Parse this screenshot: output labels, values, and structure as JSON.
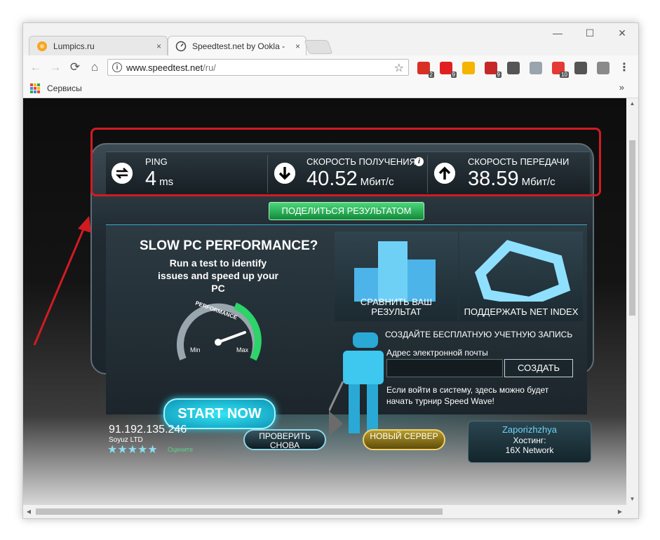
{
  "browser": {
    "tabs": [
      {
        "title": "Lumpics.ru",
        "close": "×"
      },
      {
        "title": "Speedtest.net by Ookla -",
        "close": "×"
      }
    ],
    "window_controls": {
      "minimize": "—",
      "maximize": "☐",
      "close": "✕"
    },
    "nav": {
      "back": "←",
      "forward": "→",
      "reload": "⟳",
      "home": "⌂"
    },
    "address": {
      "host": "www.speedtest.net",
      "path": "/ru/",
      "info": "i",
      "star": "☆"
    },
    "extensions": [
      {
        "name": "gmail-icon",
        "badge": "2",
        "color": "#d93025"
      },
      {
        "name": "opera-icon",
        "badge": "9",
        "color": "#e02020"
      },
      {
        "name": "paw-icon",
        "badge": "",
        "color": "#f4b400"
      },
      {
        "name": "adblock-icon",
        "badge": "9",
        "color": "#c62828"
      },
      {
        "name": "film-icon",
        "badge": "",
        "color": "#555555"
      },
      {
        "name": "vk-icon",
        "badge": "",
        "color": "#9aa4ad"
      },
      {
        "name": "red-icon",
        "badge": "10",
        "color": "#e53935"
      },
      {
        "name": "eye-icon",
        "badge": "",
        "color": "#555555"
      },
      {
        "name": "cloud-icon",
        "badge": "",
        "color": "#8a8a8a"
      }
    ],
    "menu": "⋮",
    "bookmarks": {
      "apps_label": "Сервисы",
      "more": "»"
    }
  },
  "speedtest": {
    "ping": {
      "label": "PING",
      "value": "4",
      "unit": "ms"
    },
    "download": {
      "label": "СКОРОСТЬ ПОЛУЧЕНИЯ",
      "value": "40.52",
      "unit": "Мбит/с"
    },
    "upload": {
      "label": "СКОРОСТЬ ПЕРЕДАЧИ",
      "value": "38.59",
      "unit": "Мбит/с"
    },
    "share_button": "ПОДЕЛИТЬСЯ РЕЗУЛЬТАТОМ",
    "ad": {
      "title": "SLOW PC PERFORMANCE?",
      "text": "Run a test to identify issues and speed up your PC",
      "gauge_label": "PERFORMANCE",
      "gauge_min": "Min",
      "gauge_max": "Max",
      "start_button": "START NOW"
    },
    "tiles": {
      "compare": "СРАВНИТЬ ВАШ РЕЗУЛЬТАТ",
      "support": "ПОДДЕРЖАТЬ NET INDEX"
    },
    "account": {
      "title": "СОЗДАЙТЕ БЕСПЛАТНУЮ УЧЕТНУЮ ЗАПИСЬ",
      "email_label": "Адрес электронной почты",
      "email_value": "",
      "create_button": "СОЗДАТЬ",
      "note": "Если войти в систему, здесь можно будет начать турнир Speed Wave!"
    },
    "footer": {
      "ip": "91.192.135.246",
      "isp": "Soyuz LTD",
      "stars": "★★★★★",
      "rate_label": "Оцените",
      "retest_button": "ПРОВЕРИТЬ СНОВА",
      "new_server_button": "НОВЫЙ СЕРВЕР",
      "host_city": "Zaporizhzhya",
      "host_label": "Хостинг:",
      "host_name": "16X Network"
    }
  },
  "colors": {
    "highlight": "#d11b22",
    "accent_cyan": "#2fd3f0",
    "share_green": "#1fa84a"
  }
}
